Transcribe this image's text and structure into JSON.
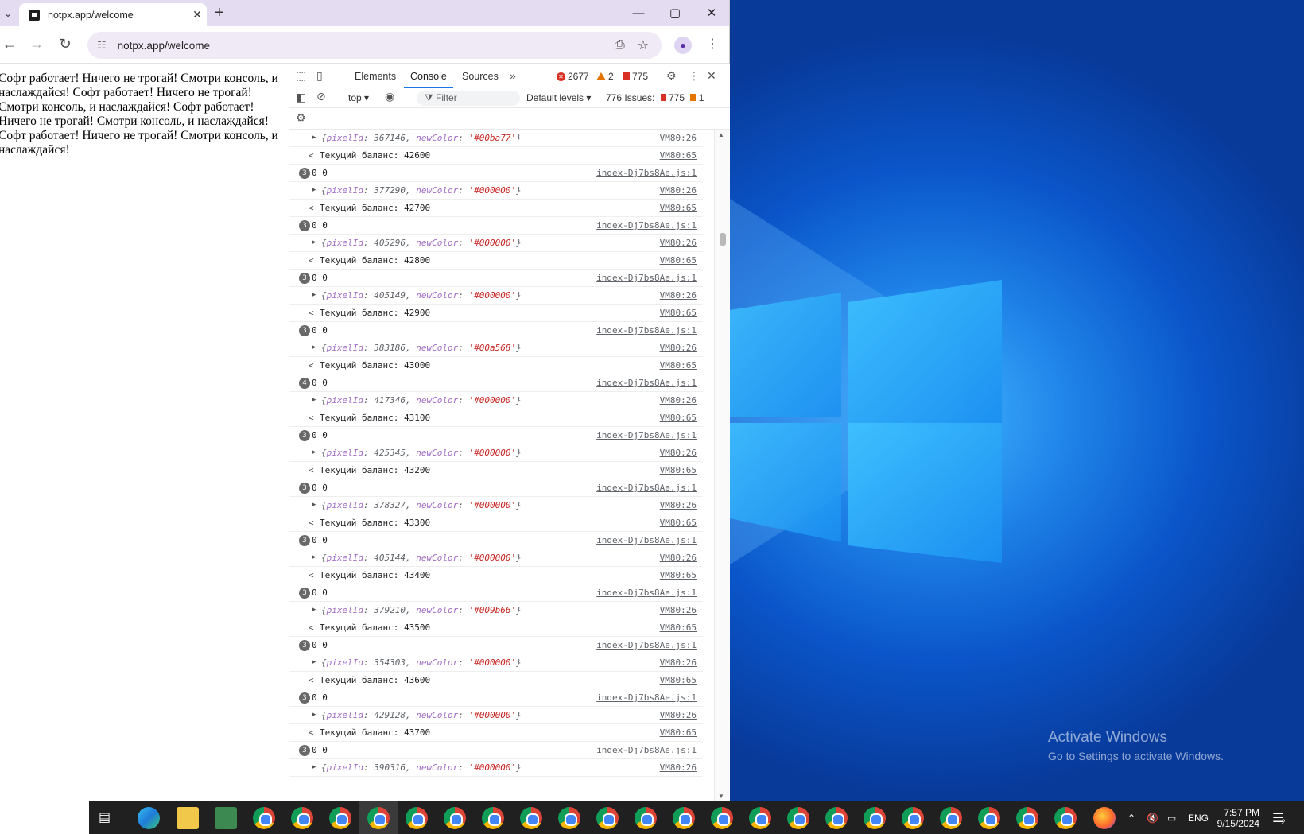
{
  "browser": {
    "tab_title": "notpx.app/welcome",
    "url": "notpx.app/welcome",
    "page_text": "Софт работает! Ничего не трогай! Смотри консоль, и наслаждайся! Софт работает! Ничего не трогай! Смотри консоль, и наслаждайся! Софт работает! Ничего не трогай! Смотри консоль, и наслаждайся! Софт работает! Ничего не трогай! Смотри консоль, и наслаждайся!"
  },
  "devtools": {
    "tabs": [
      "Elements",
      "Console",
      "Sources"
    ],
    "active_tab": "Console",
    "errors": "2677",
    "warnings": "2",
    "issues_badge": "775",
    "context": "top",
    "filter_placeholder": "Filter",
    "levels": "Default levels",
    "issues_label": "776 Issues:",
    "issues_err": "775",
    "issues_warn": "1"
  },
  "console": {
    "rows": [
      {
        "type": "obj",
        "pixelId": "367146",
        "color": "'#00ba77'",
        "src": "VM80:26"
      },
      {
        "type": "ret",
        "text": "Текущий баланс: 42600",
        "src": "VM80:65"
      },
      {
        "type": "cnt",
        "count": "3",
        "text": "0 0",
        "src": "index-Dj7bs8Ae.js:1"
      },
      {
        "type": "obj",
        "pixelId": "377290",
        "color": "'#000000'",
        "src": "VM80:26"
      },
      {
        "type": "ret",
        "text": "Текущий баланс: 42700",
        "src": "VM80:65"
      },
      {
        "type": "cnt",
        "count": "3",
        "text": "0 0",
        "src": "index-Dj7bs8Ae.js:1"
      },
      {
        "type": "obj",
        "pixelId": "405296",
        "color": "'#000000'",
        "src": "VM80:26"
      },
      {
        "type": "ret",
        "text": "Текущий баланс: 42800",
        "src": "VM80:65"
      },
      {
        "type": "cnt",
        "count": "3",
        "text": "0 0",
        "src": "index-Dj7bs8Ae.js:1"
      },
      {
        "type": "obj",
        "pixelId": "405149",
        "color": "'#000000'",
        "src": "VM80:26"
      },
      {
        "type": "ret",
        "text": "Текущий баланс: 42900",
        "src": "VM80:65"
      },
      {
        "type": "cnt",
        "count": "3",
        "text": "0 0",
        "src": "index-Dj7bs8Ae.js:1"
      },
      {
        "type": "obj",
        "pixelId": "383186",
        "color": "'#00a568'",
        "src": "VM80:26"
      },
      {
        "type": "ret",
        "text": "Текущий баланс: 43000",
        "src": "VM80:65"
      },
      {
        "type": "cnt",
        "count": "4",
        "text": "0 0",
        "src": "index-Dj7bs8Ae.js:1"
      },
      {
        "type": "obj",
        "pixelId": "417346",
        "color": "'#000000'",
        "src": "VM80:26"
      },
      {
        "type": "ret",
        "text": "Текущий баланс: 43100",
        "src": "VM80:65"
      },
      {
        "type": "cnt",
        "count": "3",
        "text": "0 0",
        "src": "index-Dj7bs8Ae.js:1"
      },
      {
        "type": "obj",
        "pixelId": "425345",
        "color": "'#000000'",
        "src": "VM80:26"
      },
      {
        "type": "ret",
        "text": "Текущий баланс: 43200",
        "src": "VM80:65"
      },
      {
        "type": "cnt",
        "count": "3",
        "text": "0 0",
        "src": "index-Dj7bs8Ae.js:1"
      },
      {
        "type": "obj",
        "pixelId": "378327",
        "color": "'#000000'",
        "src": "VM80:26"
      },
      {
        "type": "ret",
        "text": "Текущий баланс: 43300",
        "src": "VM80:65"
      },
      {
        "type": "cnt",
        "count": "3",
        "text": "0 0",
        "src": "index-Dj7bs8Ae.js:1"
      },
      {
        "type": "obj",
        "pixelId": "405144",
        "color": "'#000000'",
        "src": "VM80:26"
      },
      {
        "type": "ret",
        "text": "Текущий баланс: 43400",
        "src": "VM80:65"
      },
      {
        "type": "cnt",
        "count": "3",
        "text": "0 0",
        "src": "index-Dj7bs8Ae.js:1"
      },
      {
        "type": "obj",
        "pixelId": "379210",
        "color": "'#009b66'",
        "src": "VM80:26"
      },
      {
        "type": "ret",
        "text": "Текущий баланс: 43500",
        "src": "VM80:65"
      },
      {
        "type": "cnt",
        "count": "3",
        "text": "0 0",
        "src": "index-Dj7bs8Ae.js:1"
      },
      {
        "type": "obj",
        "pixelId": "354303",
        "color": "'#000000'",
        "src": "VM80:26"
      },
      {
        "type": "ret",
        "text": "Текущий баланс: 43600",
        "src": "VM80:65"
      },
      {
        "type": "cnt",
        "count": "3",
        "text": "0 0",
        "src": "index-Dj7bs8Ae.js:1"
      },
      {
        "type": "obj",
        "pixelId": "429128",
        "color": "'#000000'",
        "src": "VM80:26"
      },
      {
        "type": "ret",
        "text": "Текущий баланс: 43700",
        "src": "VM80:65"
      },
      {
        "type": "cnt",
        "count": "3",
        "text": "0 0",
        "src": "index-Dj7bs8Ae.js:1"
      },
      {
        "type": "obj",
        "pixelId": "390316",
        "color": "'#000000'",
        "src": "VM80:26"
      }
    ]
  },
  "desktop": {
    "activate_title": "Activate Windows",
    "activate_sub": "Go to Settings to activate Windows."
  },
  "taskbar": {
    "lang": "ENG",
    "time": "7:57 PM",
    "date": "9/15/2024",
    "notif_count": "2",
    "chrome_instances": 22
  }
}
